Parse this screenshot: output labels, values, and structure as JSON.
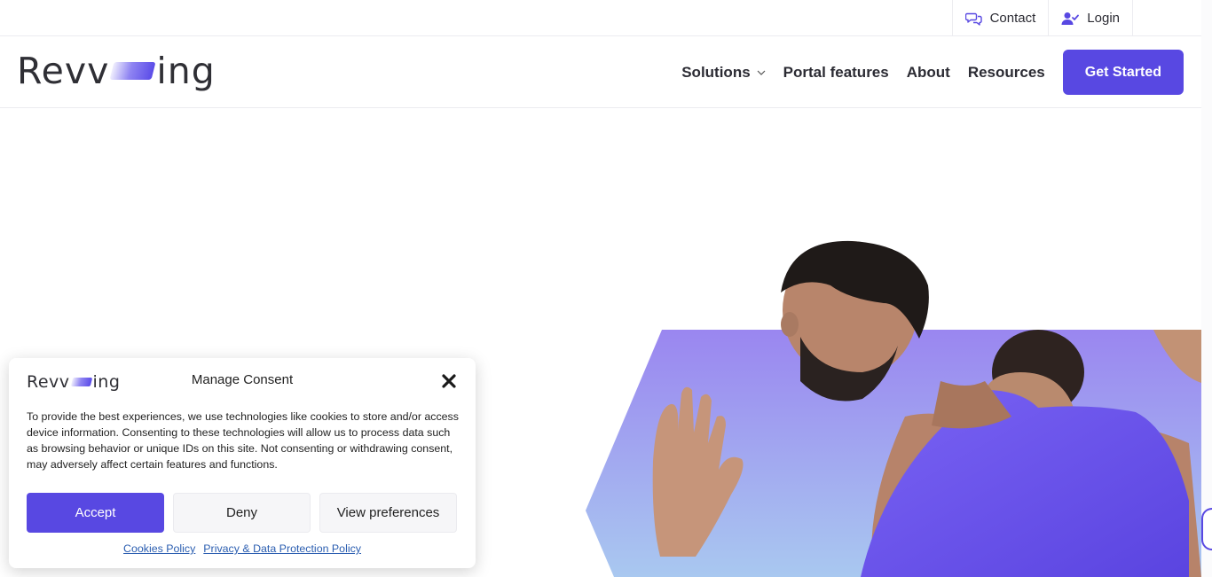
{
  "topbar": {
    "contact_label": "Contact",
    "login_label": "Login",
    "icons": {
      "contact": "chat-bubbles-icon",
      "login": "user-check-icon"
    }
  },
  "header": {
    "logo": {
      "left": "Revv",
      "right": "ing"
    },
    "nav": [
      {
        "label": "Solutions",
        "has_dropdown": true
      },
      {
        "label": "Portal features"
      },
      {
        "label": "About"
      },
      {
        "label": "Resources"
      }
    ],
    "cta_label": "Get Started"
  },
  "consent": {
    "title": "Manage Consent",
    "body": "To provide the best experiences, we use technologies like cookies to store and/or access device information. Consenting to these technologies will allow us to process data such as browsing behavior or unique IDs on this site. Not consenting or withdrawing consent, may adversely affect certain features and functions.",
    "accept_label": "Accept",
    "deny_label": "Deny",
    "preferences_label": "View preferences",
    "links": [
      "Cookies Policy",
      "Privacy & Data Protection Policy"
    ]
  },
  "colors": {
    "brand": "#5848e2",
    "hero_gradient_top": "#9a86f0",
    "hero_gradient_bottom": "#a9c8f0"
  }
}
